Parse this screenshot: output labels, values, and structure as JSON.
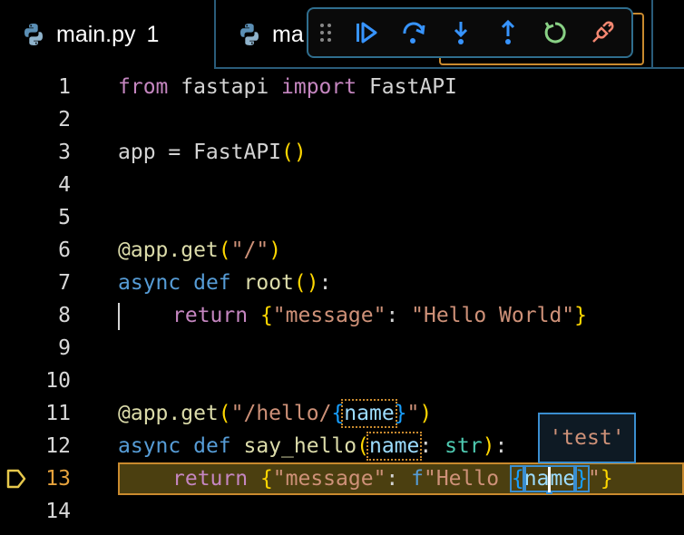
{
  "tabs": [
    {
      "label": "main.py",
      "badge": "1",
      "icon": "python-icon"
    },
    {
      "label": "ma",
      "icon": "python-icon"
    },
    {
      "label": "",
      "icon": "python-icon"
    }
  ],
  "debug_toolbar": {
    "items": [
      "drag-handle-icon",
      "continue-icon",
      "step-over-icon",
      "step-into-icon",
      "step-out-icon",
      "restart-icon",
      "disconnect-icon"
    ],
    "colors": {
      "primary": "#3794ff",
      "restart": "#89d185",
      "disconnect": "#f48771"
    }
  },
  "editor": {
    "current_line": 13,
    "line_numbers": [
      "1",
      "2",
      "3",
      "4",
      "5",
      "6",
      "7",
      "8",
      "9",
      "10",
      "11",
      "12",
      "13",
      "14"
    ],
    "lines": {
      "l1": {
        "from": "from",
        "mod": " fastapi ",
        "import": "import",
        "name": " FastAPI"
      },
      "l3": {
        "app": "app = FastAPI",
        "paren": "()"
      },
      "l6": {
        "dec": "@app.get",
        "open": "(",
        "path": "\"/\"",
        "close": ")"
      },
      "l7": {
        "async": "async",
        "def": " def ",
        "fn": "root",
        "paren": "()",
        "colon": ":"
      },
      "l8": {
        "ret": "return",
        "open": " {",
        "key": "\"message\"",
        "colon": ": ",
        "val": "\"Hello World\"",
        "close": "}"
      },
      "l11": {
        "dec": "@app.get",
        "open": "(",
        "path_a": "\"/hello/",
        "brace_open": "{",
        "var": "name",
        "brace_close": "}",
        "path_b": "\"",
        "close": ")"
      },
      "l12": {
        "async": "async",
        "def": " def ",
        "fn": "say_hello",
        "open": "(",
        "param": "name",
        "colon": ": ",
        "ty": "str",
        "close": ")",
        "end": ":"
      },
      "l13": {
        "ret": "return",
        "open": " {",
        "key": "\"message\"",
        "colon": ": ",
        "f": "f",
        "str_a": "\"Hello ",
        "brace_open": "{",
        "var_a": "na",
        "var_b": "me",
        "brace_close": "}",
        "str_b": "\"",
        "close": "}"
      }
    }
  },
  "hover": {
    "value": "'test'"
  }
}
